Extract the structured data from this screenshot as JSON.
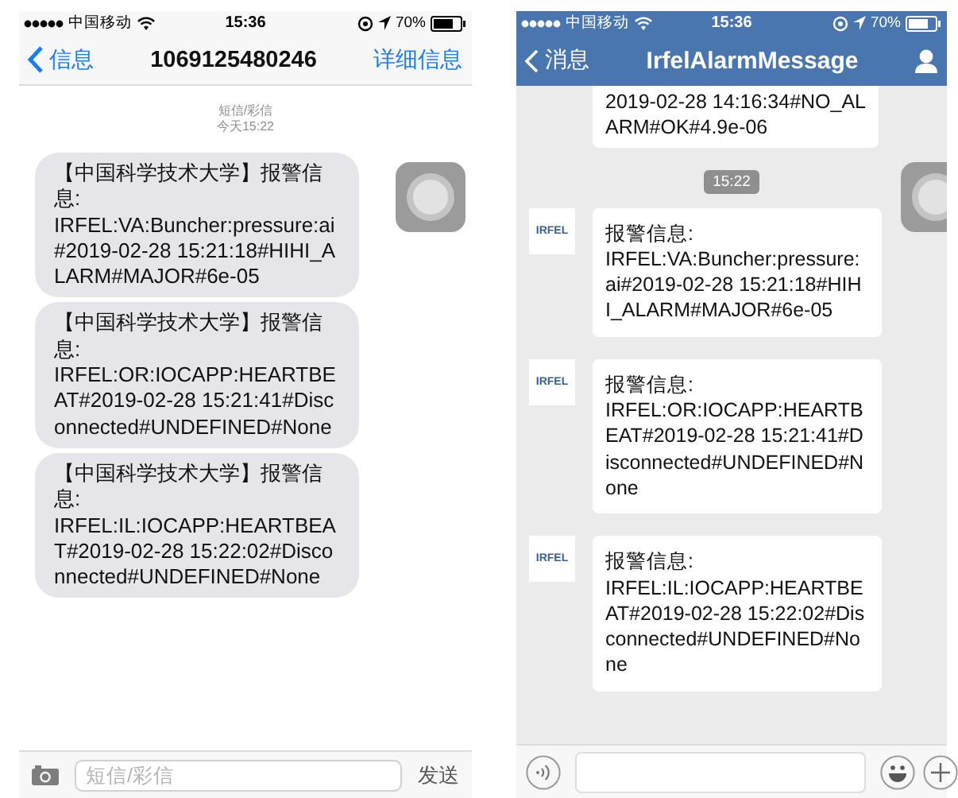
{
  "left_screen": {
    "status_bar": {
      "carrier": "中国移动",
      "time": "15:36",
      "battery": "70%"
    },
    "nav": {
      "back": "信息",
      "title": "1069125480246",
      "action": "详细信息"
    },
    "meta": {
      "type": "短信/彩信",
      "time": "今天15:22"
    },
    "messages": [
      {
        "text": "【中国科学技术大学】报警信息:\nIRFEL:VA:Buncher:pressure:ai#2019-02-28 15:21:18#HIHI_ALARM#MAJOR#6e-05"
      },
      {
        "text": "【中国科学技术大学】报警信息:\nIRFEL:OR:IOCAPP:HEARTBEAT#2019-02-28 15:21:41#Disconnected#UNDEFINED#None"
      },
      {
        "text": "【中国科学技术大学】报警信息:\nIRFEL:IL:IOCAPP:HEARTBEAT#2019-02-28 15:22:02#Disconnected#UNDEFINED#None"
      }
    ],
    "composer": {
      "placeholder": "短信/彩信",
      "send": "发送"
    }
  },
  "right_screen": {
    "status_bar": {
      "carrier": "中国移动",
      "time": "15:36",
      "battery": "70%"
    },
    "nav": {
      "back": "消息",
      "title": "IrfelAlarmMessage"
    },
    "messages": [
      {
        "kind": "partial",
        "text": "2019-02-28 14:16:34#NO_ALARM#OK#4.9e-06"
      },
      {
        "kind": "time",
        "text": "15:22"
      },
      {
        "kind": "incoming",
        "avatar": "IRFEL",
        "text": "报警信息:\nIRFEL:VA:Buncher:pressure:ai#2019-02-28 15:21:18#HIHI_ALARM#MAJOR#6e-05"
      },
      {
        "kind": "incoming",
        "avatar": "IRFEL",
        "text": "报警信息:\nIRFEL:OR:IOCAPP:HEARTBEAT#2019-02-28 15:21:41#Disconnected#UNDEFINED#None"
      },
      {
        "kind": "incoming",
        "avatar": "IRFEL",
        "text": "报警信息:\nIRFEL:IL:IOCAPP:HEARTBEAT#2019-02-28 15:22:02#Disconnected#UNDEFINED#None"
      }
    ]
  }
}
